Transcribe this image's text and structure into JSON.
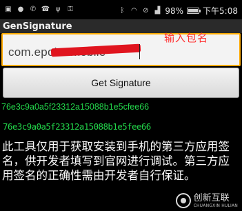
{
  "status_bar": {
    "left_icons": [
      "image-icon",
      "chat-icon",
      "phone-icon",
      "call-icon",
      "usb-icon",
      "key-icon"
    ],
    "right_icons": [
      "bluetooth-icon",
      "wifi-icon",
      "mute-icon",
      "signal-icon"
    ],
    "battery": "98%",
    "time": "下午5:08"
  },
  "app": {
    "title": "GenSignature"
  },
  "input": {
    "value": "com.epoint.mobile"
  },
  "annotation": "输入包名",
  "button": {
    "label": "Get Signature"
  },
  "signatures": [
    "76e3c9a0a5f23312a15088b1e5cfee66",
    "76e3c9a0a5f23312a15088b1e5fee66"
  ],
  "description": "此工具仅用于获取安装到手机的第三方应用签名，供开发者填写到官网进行调试。第三方应用签名的正确性需由开发者自行保证。",
  "watermark": {
    "name": "创新互联",
    "sub": "CHUANGXIN HULIAN"
  },
  "colors": {
    "signature": "#22d64a",
    "input_border": "#ffaa00",
    "annotation": "#ff3030"
  }
}
